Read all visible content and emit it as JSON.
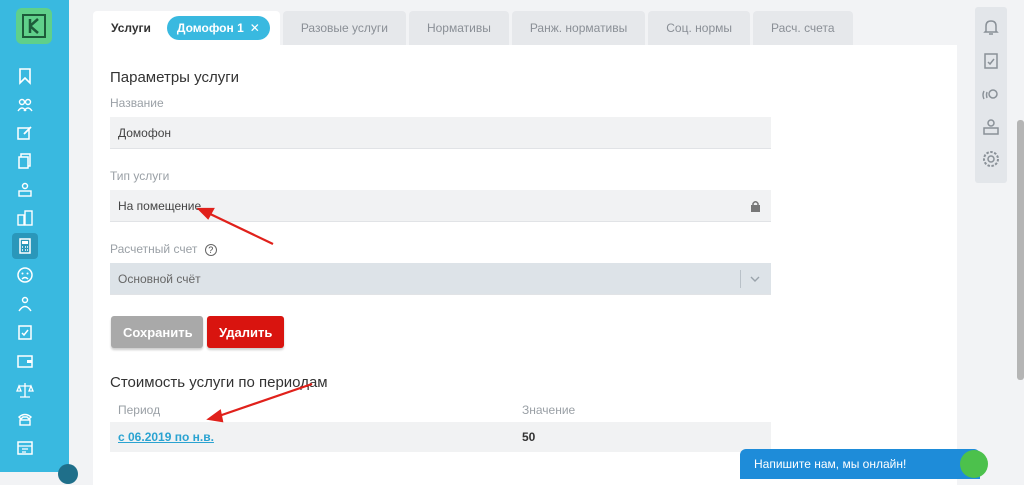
{
  "tabs": [
    {
      "label": "Услуги",
      "active": true
    },
    {
      "label": "Разовые услуги"
    },
    {
      "label": "Нормативы"
    },
    {
      "label": "Ранж. нормативы"
    },
    {
      "label": "Соц. нормы"
    },
    {
      "label": "Расч. счета"
    }
  ],
  "chip": {
    "label": "Домофон 1",
    "close": "✕"
  },
  "section_title": "Параметры услуги",
  "form": {
    "name_label": "Название",
    "name_value": "Домофон",
    "type_label": "Тип услуги",
    "type_value": "На помещение",
    "account_label": "Расчетный счет",
    "account_help": "?",
    "account_value": "Основной счёт"
  },
  "buttons": {
    "save": "Сохранить",
    "delete": "Удалить"
  },
  "periods": {
    "title": "Стоимость услуги по периодам",
    "col_period": "Период",
    "col_value": "Значение",
    "rows": [
      {
        "period": "с 06.2019 по н.в.",
        "value": "50"
      }
    ]
  },
  "chat": {
    "label": "Напишите нам, мы онлайн!"
  },
  "colors": {
    "accent": "#39b9e0",
    "logo": "#5fd08a",
    "danger": "#d9140f",
    "arrow": "#e0211b"
  }
}
